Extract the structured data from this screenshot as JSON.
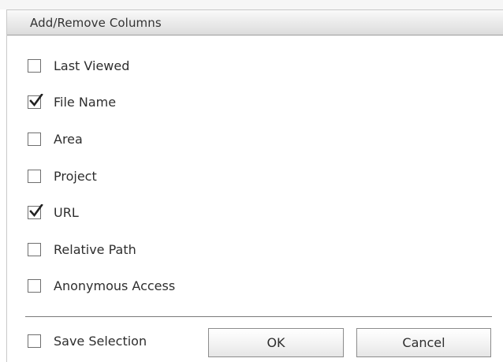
{
  "dialog": {
    "title": "Add/Remove Columns",
    "options": [
      {
        "label": "Last Viewed",
        "checked": false
      },
      {
        "label": "File Name",
        "checked": true
      },
      {
        "label": "Area",
        "checked": false
      },
      {
        "label": "Project",
        "checked": false
      },
      {
        "label": "URL",
        "checked": true
      },
      {
        "label": "Relative Path",
        "checked": false
      },
      {
        "label": "Anonymous Access",
        "checked": false
      }
    ],
    "save_selection": {
      "label": "Save Selection",
      "checked": false
    },
    "ok_label": "OK",
    "cancel_label": "Cancel"
  },
  "icons": {
    "checkbox_checked": "checkmark-icon"
  },
  "colors": {
    "checkbox_border": "#6f6f6f",
    "button_border": "#8c8c8c",
    "title_bar_bottom": "#9d9d9d"
  }
}
